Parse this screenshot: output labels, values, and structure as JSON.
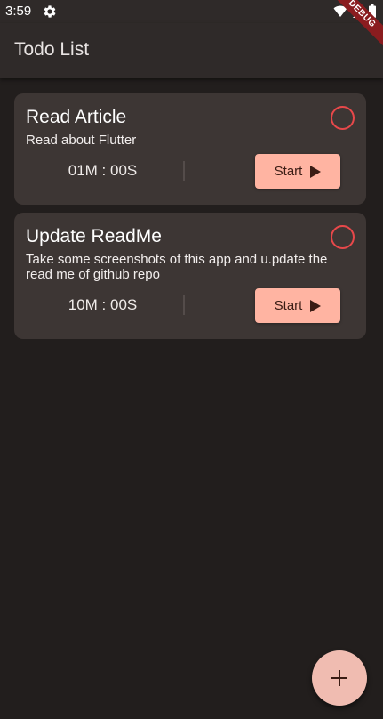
{
  "status_bar": {
    "time": "3:59"
  },
  "debug_banner": "DEBUG",
  "app_bar": {
    "title": "Todo List"
  },
  "todos": [
    {
      "title": "Read Article",
      "description": "Read about Flutter",
      "timer": "01M : 00S",
      "start_label": "Start"
    },
    {
      "title": "Update ReadMe",
      "description": "Take some screenshots of this app and u.pdate the read me of github repo",
      "timer": "10M : 00S",
      "start_label": "Start"
    }
  ],
  "colors": {
    "background": "#221e1d",
    "card": "#3d3634",
    "accent": "#ffb4a2",
    "done_ring": "#e8484a"
  },
  "icons": [
    "settings-gear-icon",
    "wifi-icon",
    "signal-icon",
    "battery-icon",
    "play-icon",
    "plus-icon"
  ]
}
